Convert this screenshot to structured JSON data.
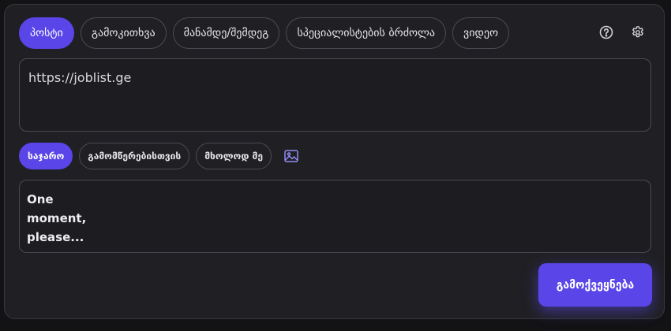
{
  "tabs": [
    {
      "label": "პოსტი",
      "active": true
    },
    {
      "label": "გამოკითხვა",
      "active": false
    },
    {
      "label": "მანამდე/შემდეგ",
      "active": false
    },
    {
      "label": "სპეციალისტების ბრძოლა",
      "active": false
    },
    {
      "label": "ვიდეო",
      "active": false
    }
  ],
  "header_icons": [
    "help-circle-icon",
    "settings-gear-icon"
  ],
  "url_input": {
    "value": "https://joblist.ge"
  },
  "privacy": {
    "options": [
      {
        "label": "საჯარო",
        "active": true
      },
      {
        "label": "გამომწერებისთვის",
        "active": false
      },
      {
        "label": "მხოლოდ მე",
        "active": false
      }
    ],
    "image_icon": "image-icon"
  },
  "message": {
    "text": "One moment, please..."
  },
  "publish": {
    "label": "გამოქვეყნება"
  },
  "colors": {
    "accent": "#5a45e8",
    "panel_bg": "#202024",
    "page_bg": "#131316",
    "border": "#4a4a52",
    "text": "#e6e6ea"
  }
}
